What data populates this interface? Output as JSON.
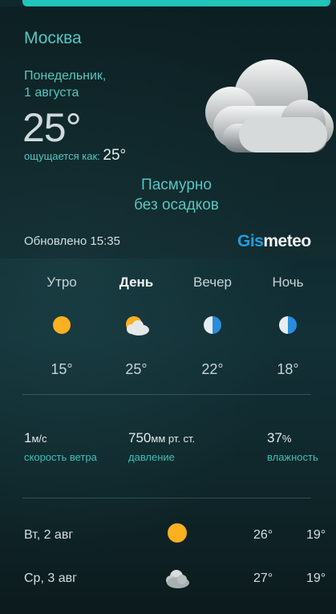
{
  "header": {
    "city": "Москва",
    "date_line1": "Понедельник,",
    "date_line2": "1 августа",
    "temperature": "25°",
    "feels_label": "ощущается как:",
    "feels_value": "25°",
    "condition_line1": "Пасмурно",
    "condition_line2": "без осадков",
    "updated": "Обновлено 15:35",
    "logo_part1": "Gis",
    "logo_part2": "meteo",
    "icon": "cloud-icon"
  },
  "periods": [
    {
      "name": "Утро",
      "temp": "15°",
      "icon": "sun-icon",
      "active": false
    },
    {
      "name": "День",
      "temp": "25°",
      "icon": "partly-cloudy-icon",
      "active": true
    },
    {
      "name": "Вечер",
      "temp": "22°",
      "icon": "half-moon-icon",
      "active": false
    },
    {
      "name": "Ночь",
      "temp": "18°",
      "icon": "half-moon-icon",
      "active": false
    }
  ],
  "stats": {
    "wind_value": "1",
    "wind_unit": "м/с",
    "wind_label": "скорость ветра",
    "pressure_value": "750",
    "pressure_unit": "мм рт. ст.",
    "pressure_label": "давление",
    "humidity_value": "37",
    "humidity_unit": "%",
    "humidity_label": "влажность"
  },
  "forecast": [
    {
      "date": "Вт, 2 авг",
      "max": "26°",
      "min": "19°",
      "icon": "sun-icon"
    },
    {
      "date": "Ср, 3 авг",
      "max": "27°",
      "min": "19°",
      "icon": "cloud-icon"
    }
  ],
  "colors": {
    "accent": "#54c7bf",
    "bar": "#1fc6b9",
    "sun": "#fbb01f",
    "logo_blue": "#1d9dde"
  }
}
